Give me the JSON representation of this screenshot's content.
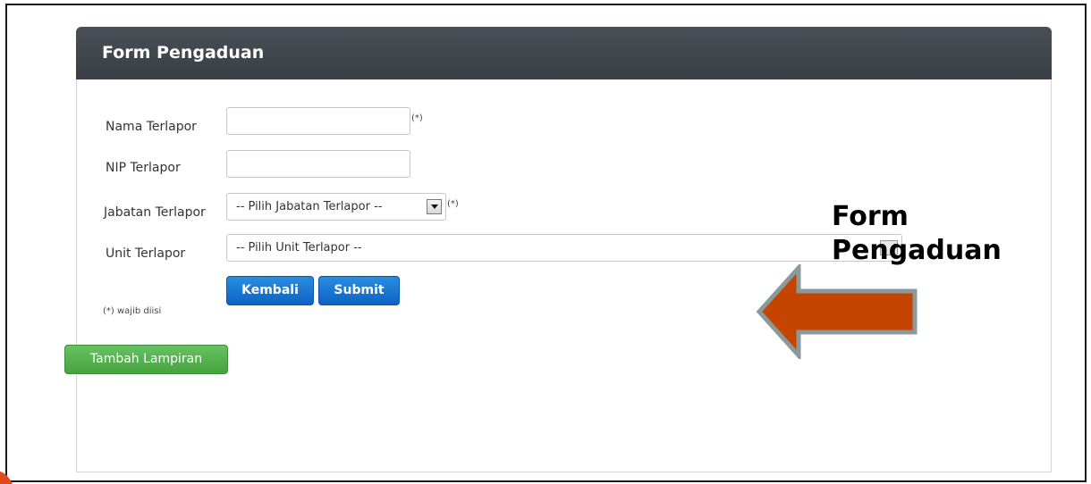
{
  "panel": {
    "title": "Form Pengaduan"
  },
  "form": {
    "nama_label": "Nama Terlapor",
    "nama_value": "",
    "nama_required": "(*)",
    "nip_label": "NIP Terlapor",
    "nip_value": "",
    "jabatan_label": "Jabatan Terlapor",
    "jabatan_selected": "-- Pilih Jabatan Terlapor --",
    "jabatan_required": "(*)",
    "unit_label": "Unit Terlapor",
    "unit_selected": "-- Pilih Unit Terlapor --",
    "required_note": "(*) wajib diisi"
  },
  "buttons": {
    "back": "Kembali",
    "submit": "Submit",
    "add_attachment": "Tambah Lampiran"
  },
  "annotation": {
    "line1": "Form",
    "line2": "Pengaduan",
    "arrow_color": "#c54400",
    "arrow_border_color": "#8a9a9a"
  },
  "icons": {
    "jabatan_dropdown": "chevron-down-icon",
    "unit_dropdown": "chevron-down-icon",
    "annotation_arrow": "left-arrow-icon"
  }
}
